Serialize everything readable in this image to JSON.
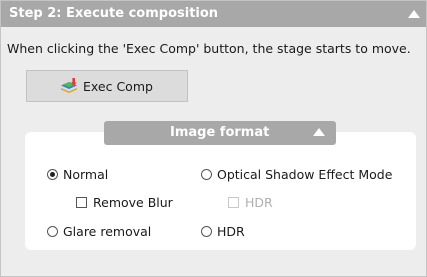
{
  "panel": {
    "title": "Step 2: Execute composition",
    "collapse_icon": "chevron-up-icon",
    "description": "When clicking the 'Exec Comp' button, the stage starts to move."
  },
  "exec_button": {
    "label": "Exec Comp",
    "icon": "layers-download-icon"
  },
  "image_format": {
    "title": "Image format",
    "collapse_icon": "chevron-up-icon",
    "options": {
      "normal": {
        "label": "Normal",
        "selected": true
      },
      "remove_blur": {
        "label": "Remove Blur",
        "checked": false
      },
      "optical_shadow": {
        "label": "Optical Shadow Effect Mode",
        "selected": false
      },
      "hdr_check": {
        "label": "HDR",
        "checked": false,
        "enabled": false
      },
      "glare_removal": {
        "label": "Glare removal",
        "selected": false
      },
      "hdr_radio": {
        "label": "HDR",
        "selected": false
      }
    }
  },
  "colors": {
    "header_bg": "#a8a8a8",
    "panel_bg": "#ededed",
    "button_bg": "#dcdcdc"
  }
}
